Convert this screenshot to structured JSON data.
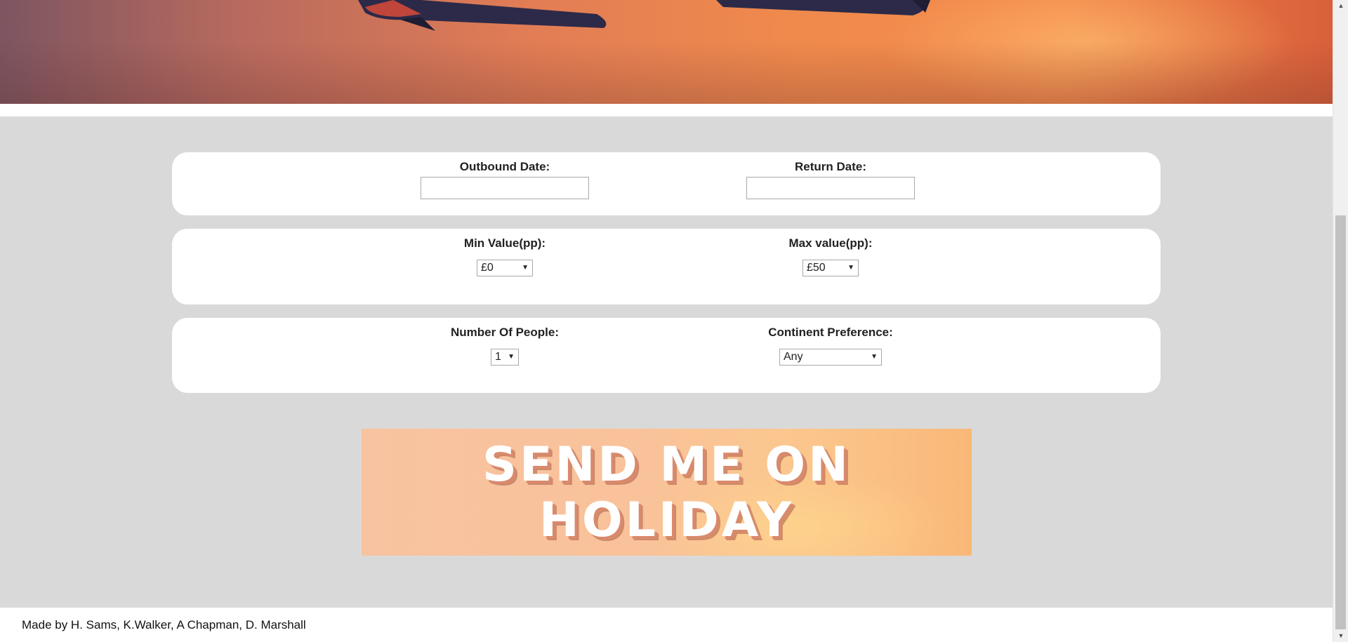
{
  "form": {
    "outbound_date": {
      "label": "Outbound Date:",
      "value": ""
    },
    "return_date": {
      "label": "Return Date:",
      "value": ""
    },
    "min_value": {
      "label": "Min Value(pp):",
      "selected": "£0"
    },
    "max_value": {
      "label": "Max value(pp):",
      "selected": "£50"
    },
    "people": {
      "label": "Number Of People:",
      "selected": "1"
    },
    "continent": {
      "label": "Continent Preference:",
      "selected": "Any"
    }
  },
  "submit": {
    "label": "Send me on holiday"
  },
  "footer": {
    "credits": "Made by H. Sams, K.Walker, A Chapman, D. Marshall"
  },
  "scrollbar": {
    "up_arrow": "▲",
    "down_arrow": "▼"
  },
  "select_arrow": "▼",
  "colors": {
    "page_background": "#d9d9d9",
    "panel_background": "#ffffff",
    "hero_orange": "#f08a4c"
  }
}
